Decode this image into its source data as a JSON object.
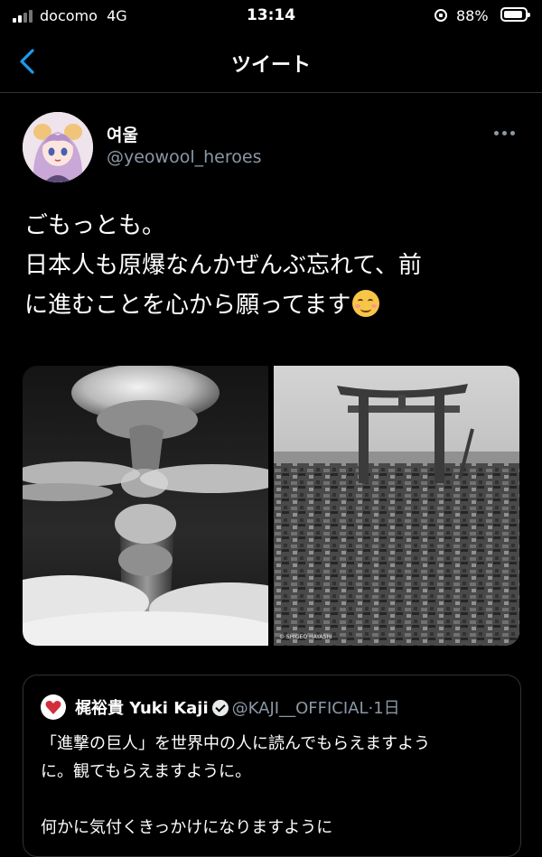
{
  "status_bar": {
    "carrier": "docomo",
    "network": "4G",
    "time": "13:14",
    "battery": "88%",
    "icons": [
      "signal-icon",
      "orientation-lock-icon",
      "battery-icon"
    ]
  },
  "nav": {
    "title": "ツイート",
    "back_icon": "chevron-left-icon",
    "accent_color": "#1d9bf0"
  },
  "tweet": {
    "display_name": "여울",
    "handle": "@yeowool_heroes",
    "text_lines": [
      "ごもっとも。",
      "日本人も原爆なんかぜんぶ忘れて、前",
      "に進むことを心から願ってます"
    ],
    "emoji": "smiling-face-emoji",
    "photo_watermark": "© SHIGEO HAYASHI"
  },
  "quoted_tweet": {
    "display_name": "梶裕貴 Yuki Kaji",
    "handle": "@KAJI__OFFICIAL",
    "separator": "·",
    "time": "1日",
    "text_lines": [
      "「進撃の巨人」を世界中の人に読んでもらえますよう",
      "に。観てもらえますように。",
      "",
      "何かに気付くきっかけになりますように"
    ]
  }
}
